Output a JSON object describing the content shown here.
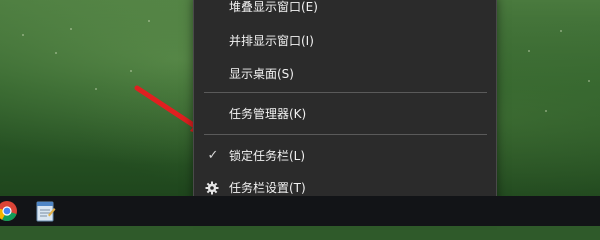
{
  "context_menu": {
    "items": [
      {
        "label": "堆叠显示窗口(E)"
      },
      {
        "label": "并排显示窗口(I)"
      },
      {
        "label": "显示桌面(S)"
      },
      {
        "label": "任务管理器(K)"
      },
      {
        "label": "锁定任务栏(L)",
        "checked": true
      },
      {
        "label": "任务栏设置(T)",
        "icon": "gear-icon"
      }
    ]
  },
  "annotation": {
    "color": "#e02020",
    "icon": "red-arrow-icon"
  },
  "taskbar": {
    "pinned": [
      {
        "icon": "chrome-icon"
      },
      {
        "icon": "notepad-icon"
      }
    ]
  }
}
